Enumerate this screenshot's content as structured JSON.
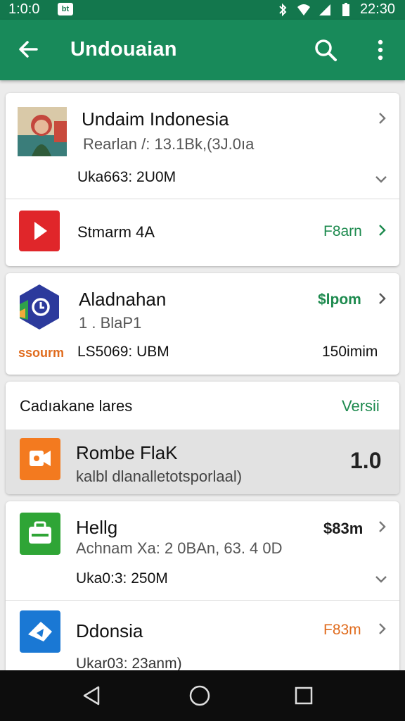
{
  "status_bar": {
    "time_left": "1:0:0",
    "notif_label": "bt",
    "time_right": "22:30"
  },
  "app_bar": {
    "title": "Undouaian"
  },
  "card1": {
    "title": "Undaim Indonesia",
    "subtitle": "Rearlan /: 13.1Bk,(3J.0ıa",
    "detail": "Uka663: 2U0M",
    "stream_label": "Stmarm 4A",
    "stream_action": "F8arn"
  },
  "card2": {
    "title": "Aladnahan",
    "subtitle": "1 . BlaP1",
    "brand": "ssourm",
    "detail": "LS5069: UBM",
    "price": "$lpom",
    "size": "150imim"
  },
  "card3": {
    "header": "Cadıakane lares",
    "header_action": "Versii",
    "item_title": "Rombe FlaK",
    "item_sub": "kalbl dlanalletotsporlaal)",
    "item_value": "1.0"
  },
  "card4": {
    "title": "Hellg",
    "subtitle": "Achnam Xa: 2 0BAn, 63. 4 0D",
    "detail": "Uka0:3: 250M",
    "price": "$83m",
    "item2_title": "Ddonsia",
    "item2_action": "F83m",
    "item2_detail": "Ukar03: 23anm)"
  }
}
